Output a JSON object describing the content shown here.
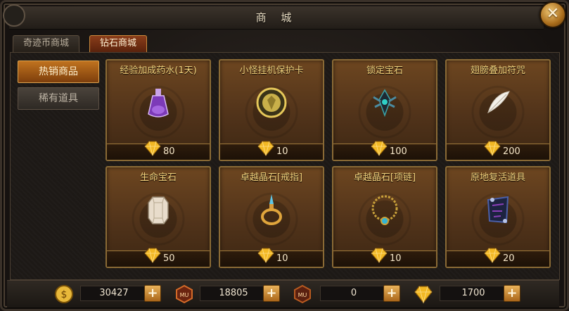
{
  "window": {
    "title": "商 城",
    "close_icon": "close-icon"
  },
  "tabs": [
    {
      "label": "奇迹币商城",
      "active": false
    },
    {
      "label": "钻石商城",
      "active": true
    }
  ],
  "sidebar": {
    "items": [
      {
        "label": "热销商品",
        "active": true
      },
      {
        "label": "稀有道具",
        "active": false
      }
    ]
  },
  "items": [
    {
      "name": "经验加成药水(1天)",
      "price": "80",
      "icon": "purple-potion-icon"
    },
    {
      "name": "小怪挂机保护卡",
      "price": "10",
      "icon": "golden-shield-card-icon"
    },
    {
      "name": "锁定宝石",
      "price": "100",
      "icon": "lock-gem-icon"
    },
    {
      "name": "翅膀叠加符咒",
      "price": "200",
      "icon": "white-feather-icon"
    },
    {
      "name": "生命宝石",
      "price": "50",
      "icon": "life-gem-icon"
    },
    {
      "name": "卓越晶石[戒指]",
      "price": "10",
      "icon": "ring-icon"
    },
    {
      "name": "卓越晶石[项链]",
      "price": "10",
      "icon": "necklace-icon"
    },
    {
      "name": "原地复活道具",
      "price": "20",
      "icon": "revive-scroll-icon"
    }
  ],
  "currencies": [
    {
      "icon": "gold-coin-icon",
      "value": "30427"
    },
    {
      "icon": "mu-token-icon",
      "value": "18805"
    },
    {
      "icon": "mu-bound-token-icon",
      "value": "0"
    },
    {
      "icon": "diamond-icon",
      "value": "1700"
    }
  ],
  "colors": {
    "item_name": "#f3d27c",
    "active_tab": "#8a3d1a",
    "active_side": "#c0731f",
    "card_border": "#8a6a35"
  }
}
